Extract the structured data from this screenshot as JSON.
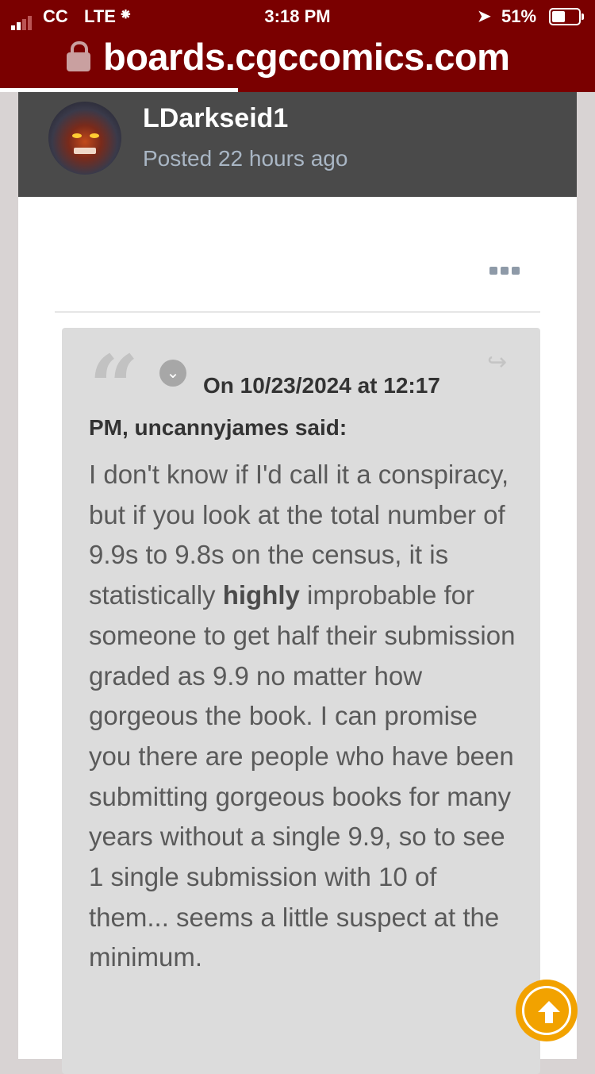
{
  "status_bar": {
    "carrier": "CC",
    "network": "LTE",
    "time": "3:18 PM",
    "battery": "51%"
  },
  "browser": {
    "url": "boards.cgccomics.com"
  },
  "post": {
    "username": "LDarkseid1",
    "posted": "Posted 22 hours ago",
    "quote": {
      "citation_line1": "On 10/23/2024 at 12:17",
      "citation_line2": "PM, uncannyjames said:",
      "text_before_bold": "I don't know if I'd call it a conspiracy, but if you look at the total number of 9.9s to 9.8s on the census, it is statistically ",
      "text_bold": "highly",
      "text_after_bold": " improbable for someone to get half their submission graded as 9.9 no matter how gorgeous the book. I can promise you there are people who have been submitting gorgeous books for many years without a single 9.9, so to see 1 single submission with 10 of them... seems a little suspect at the minimum."
    }
  },
  "icons": {
    "lock": "lock-icon",
    "menu": "more-options-icon",
    "quote": "quote-icon",
    "expand": "chevron-down-icon",
    "share": "share-icon",
    "scroll_top": "arrow-up-icon"
  },
  "colors": {
    "browser_bar": "#7a0000",
    "post_header": "#4a4a4a",
    "quote_background": "#dcdcdc",
    "scroll_button": "#f2a200"
  }
}
